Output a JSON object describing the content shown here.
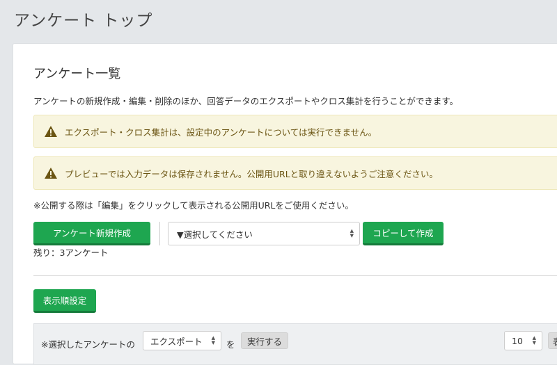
{
  "header": {
    "title": "アンケート トップ"
  },
  "card": {
    "title": "アンケート一覧",
    "description": "アンケートの新規作成・編集・削除のほか、回答データのエクスポートやクロス集計を行うことができます。",
    "alerts": [
      {
        "text": "エクスポート・クロス集計は、設定中のアンケートについては実行できません。",
        "icon": "warning-icon"
      },
      {
        "text": "プレビューでは入力データは保存されません。公開用URLと取り違えないようご注意ください。",
        "icon": "warning-icon"
      }
    ],
    "note": "※公開する際は「編集」をクリックして表示される公開用URLをご使用ください。",
    "new_button": "アンケート新規作成",
    "copy_select": {
      "selected": "▼選択してください"
    },
    "copy_button": "コピーして作成",
    "remaining": "残り：3アンケート",
    "sort_button": "表示順設定",
    "filter": {
      "prefix": "※選択したアンケートの",
      "action_select": "エクスポート",
      "particle": "を",
      "run_button": "実行する",
      "per_page": "10",
      "trailing": "表"
    }
  },
  "colors": {
    "green": "#1ea650",
    "alert_bg": "#f8f5df",
    "alert_text": "#6b5513",
    "warning_icon": "#6b5513"
  }
}
